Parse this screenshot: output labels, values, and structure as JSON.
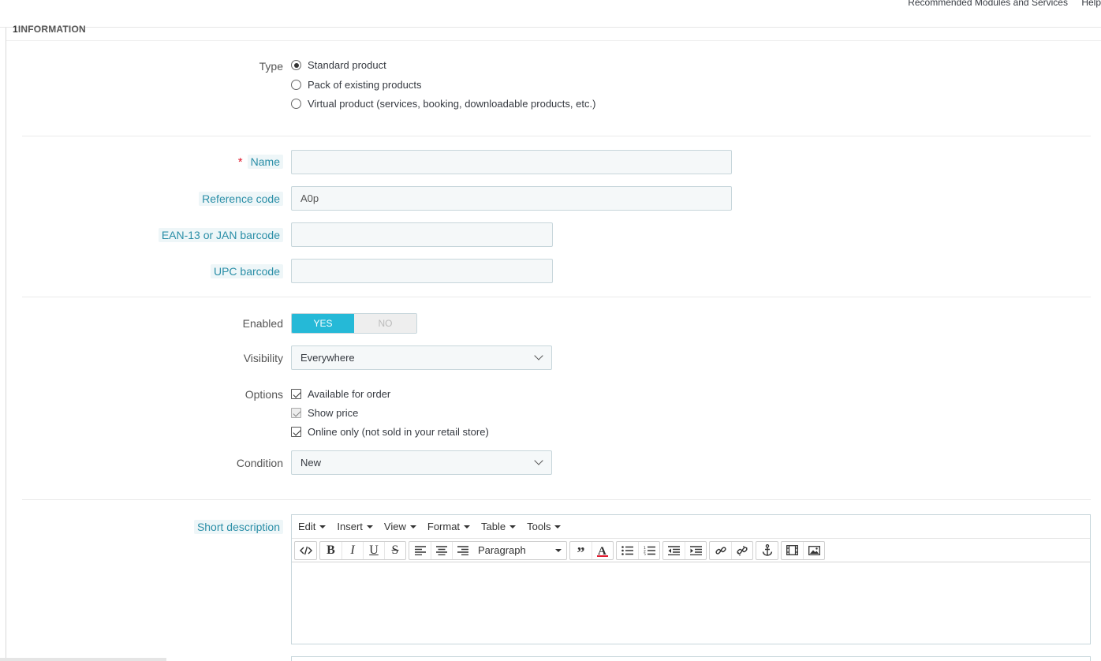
{
  "header": {
    "links": [
      "Recommended Modules and Services",
      "Help"
    ]
  },
  "panel": {
    "heading_number": "1",
    "heading": "INFORMATION"
  },
  "type_field": {
    "label": "Type",
    "options": [
      {
        "label": "Standard product",
        "selected": true
      },
      {
        "label": "Pack of existing products",
        "selected": false
      },
      {
        "label": "Virtual product (services, booking, downloadable products, etc.)",
        "selected": false
      }
    ]
  },
  "name_field": {
    "label": "Name",
    "required_mark": "*",
    "value": ""
  },
  "reference_field": {
    "label": "Reference code",
    "value": "A0p"
  },
  "ean_field": {
    "label": "EAN-13 or JAN barcode",
    "value": ""
  },
  "upc_field": {
    "label": "UPC barcode",
    "value": ""
  },
  "enabled_field": {
    "label": "Enabled",
    "yes": "YES",
    "no": "NO",
    "value": "YES"
  },
  "visibility_field": {
    "label": "Visibility",
    "value": "Everywhere"
  },
  "options_field": {
    "label": "Options",
    "items": [
      {
        "label": "Available for order",
        "checked": true,
        "disabled": false
      },
      {
        "label": "Show price",
        "checked": true,
        "disabled": true
      },
      {
        "label": "Online only (not sold in your retail store)",
        "checked": true,
        "disabled": false
      }
    ]
  },
  "condition_field": {
    "label": "Condition",
    "value": "New"
  },
  "short_description": {
    "label": "Short description",
    "menus": [
      "Edit",
      "Insert",
      "View",
      "Format",
      "Table",
      "Tools"
    ],
    "block_format": "Paraph",
    "block_format_full": "Paragraph",
    "content": ""
  },
  "colors": {
    "accent": "#25b9d7",
    "help_label": "#2a8ea7",
    "required": "#e0182d"
  }
}
